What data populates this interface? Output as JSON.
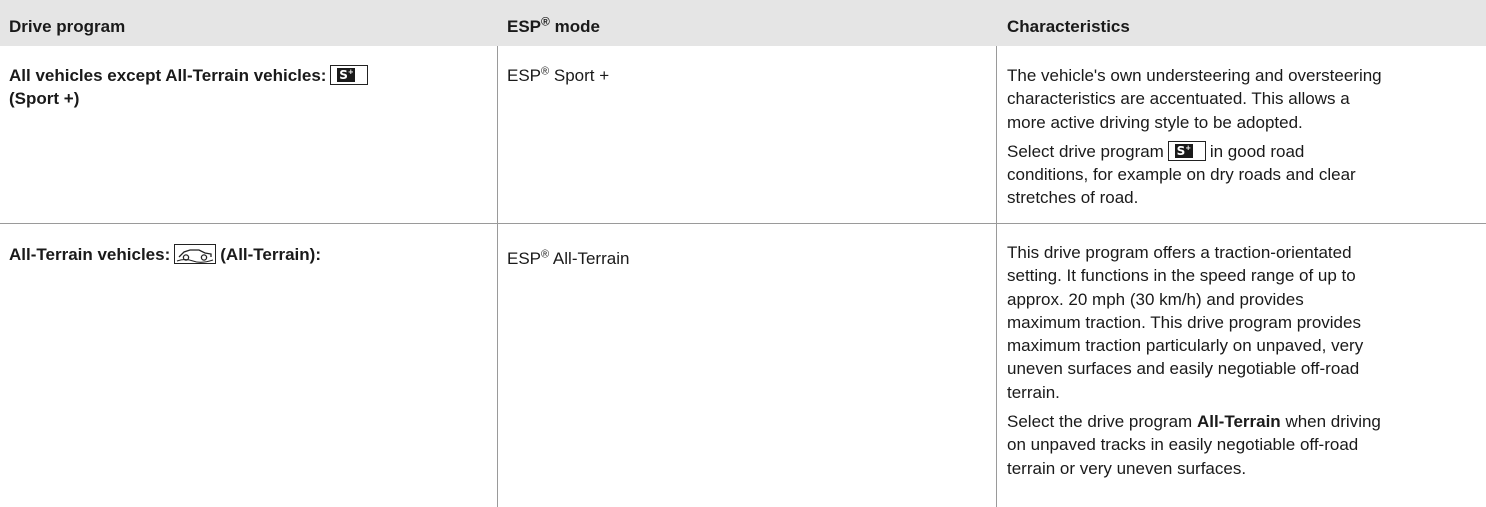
{
  "header": {
    "col1": "Drive program",
    "col2_text": "ESP",
    "col2_sup": "®",
    "col2_rest": " mode",
    "col3": "Characteristics"
  },
  "rows": [
    {
      "program_line1": "All vehicles except All-Terrain vehicles:",
      "program_line2": "(Sport +)",
      "program_icon": "sport-plus-icon",
      "esp_prefix": "ESP",
      "esp_sup": "®",
      "esp_suffix": " Sport +",
      "char_p1": "The vehicle's own understeering and oversteering characteristics are accentuated. This allows a more active driving style to be adopted.",
      "char_p2_before": "Select drive program",
      "char_p2_after": "in good road conditions, for example on dry roads and clear stretches of road."
    },
    {
      "program_line1": "All-Terrain vehicles:",
      "program_after_icon": "(All-Terrain):",
      "program_icon": "all-terrain-icon",
      "esp_prefix": "ESP",
      "esp_sup": "®",
      "esp_suffix": " All-Terrain",
      "char_p1": "This drive program offers a traction-orientated setting. It functions in the speed range of up to approx. 20 mph (30 km/h) and provides maximum traction. This drive program provides maximum traction particularly on unpaved, very uneven surfaces and easily negotiable off-road terrain.",
      "char_p2_before": "Select the drive program",
      "char_p2_bold": "All-Terrain",
      "char_p2_after": "when driving on unpaved tracks in easily negotiable off-road terrain or very uneven surfaces."
    }
  ],
  "symbols": {
    "sport_plus_glyph": "S",
    "sport_plus_sup": "+"
  }
}
